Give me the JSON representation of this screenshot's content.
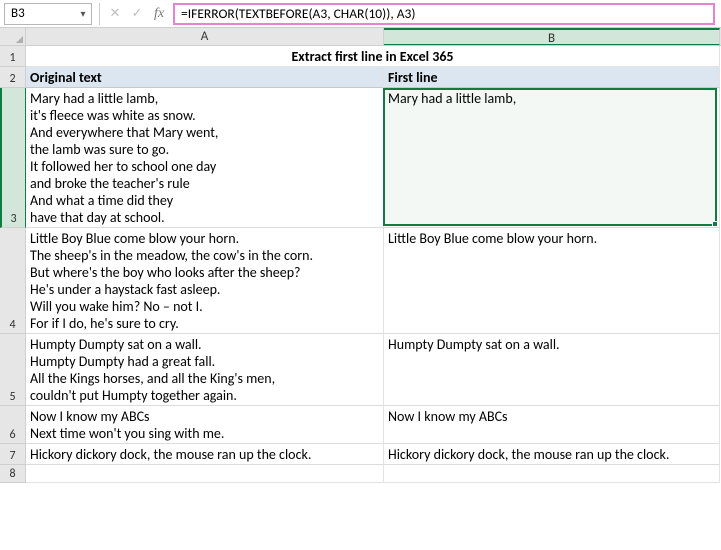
{
  "formula_bar": {
    "active_cell": "B3",
    "formula": "=IFERROR(TEXTBEFORE(A3, CHAR(10)), A3)"
  },
  "columns": {
    "A": "A",
    "B": "B"
  },
  "title": "Extract first line in Excel 365",
  "headers": {
    "original": "Original text",
    "first_line": "First line"
  },
  "rows": [
    {
      "num": "3",
      "original": "Mary had a little lamb,\nit's fleece was white as snow.\nAnd everywhere that Mary went,\nthe lamb was sure to go.\nIt followed her to school one day\nand broke the teacher's rule\nAnd what a time did they\nhave that day at school.",
      "first": "Mary had a little lamb,"
    },
    {
      "num": "4",
      "original": "Little Boy Blue come blow your horn.\nThe sheep's in the meadow, the cow's in the corn.\nBut where's the boy who looks after the sheep?\nHe's under a haystack fast asleep.\nWill you wake him? No – not I.\nFor if I do, he's sure to cry.",
      "first": "Little Boy Blue come blow your horn."
    },
    {
      "num": "5",
      "original": "Humpty Dumpty sat on a wall.\nHumpty Dumpty had a great fall.\nAll the Kings horses, and all the King's men,\ncouldn't put Humpty together again.",
      "first": "Humpty Dumpty sat on a wall."
    },
    {
      "num": "6",
      "original": "Now I know my ABCs\nNext time won't you sing with me.",
      "first": "Now I know my ABCs"
    },
    {
      "num": "7",
      "original": "Hickory dickory dock, the mouse ran up the clock.",
      "first": "Hickory dickory dock, the mouse ran up the clock."
    }
  ],
  "row_labels": {
    "r1": "1",
    "r2": "2",
    "r8": "8"
  }
}
